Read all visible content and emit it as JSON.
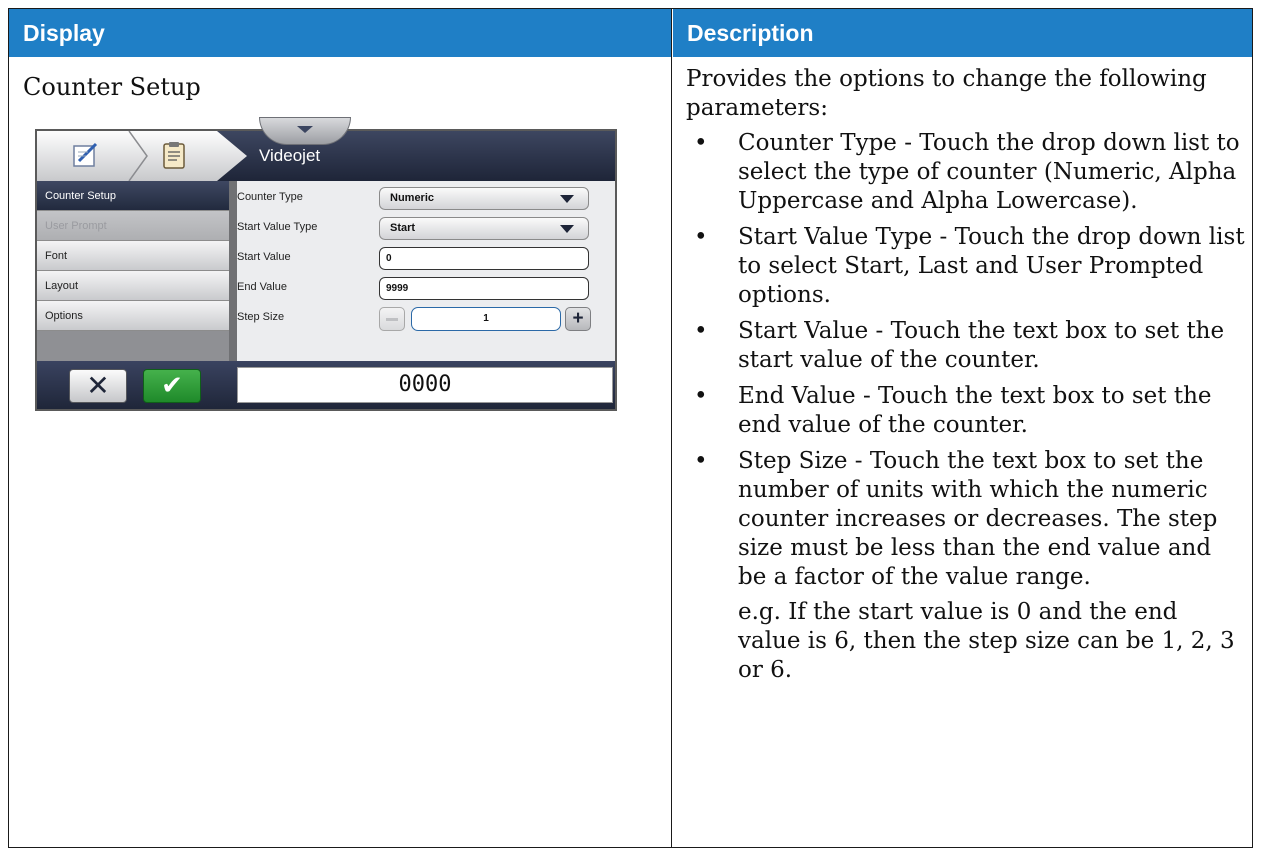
{
  "table": {
    "headers": {
      "display": "Display",
      "description": "Description"
    }
  },
  "display": {
    "title": "Counter Setup",
    "screen": {
      "app_title": "Videojet",
      "sidebar": [
        {
          "label": "Counter Setup",
          "state": "active"
        },
        {
          "label": "User Prompt",
          "state": "disabled"
        },
        {
          "label": "Font",
          "state": "normal"
        },
        {
          "label": "Layout",
          "state": "normal"
        },
        {
          "label": "Options",
          "state": "normal"
        }
      ],
      "form": {
        "counter_type": {
          "label": "Counter Type",
          "value": "Numeric"
        },
        "start_value_type": {
          "label": "Start Value Type",
          "value": "Start"
        },
        "start_value": {
          "label": "Start Value",
          "value": "0"
        },
        "end_value": {
          "label": "End Value",
          "value": "9999"
        },
        "step_size": {
          "label": "Step Size",
          "value": "1"
        }
      },
      "preview": "0000",
      "icons": [
        "edit-icon",
        "clipboard-icon",
        "chevron-down-icon",
        "close-icon",
        "check-icon",
        "minus-icon",
        "plus-icon"
      ]
    }
  },
  "description": {
    "intro": "Provides the options to change the following parameters:",
    "bullet_symbol": "•",
    "items": [
      "Counter Type - Touch the drop down list to select the type of counter (Numeric, Alpha Uppercase and Alpha Lowercase).",
      "Start Value Type - Touch the drop down list to select Start, Last and User Prompted options.",
      "Start Value - Touch the text box to set the start value of the counter.",
      "End Value - Touch the text box to set the end value of the counter.",
      "Step Size - Touch the text box to set the number of units with which the numeric counter increases or decreases. The step size must be less than the end value and be a factor of the value range."
    ],
    "note": "e.g. If the start value is 0 and the end value is 6, then the step size can be 1, 2, 3 or 6."
  },
  "colors": {
    "header_bg": "#1f7fc6",
    "screen_dark": "#1e2538",
    "ok_green": "#2e9b38"
  }
}
